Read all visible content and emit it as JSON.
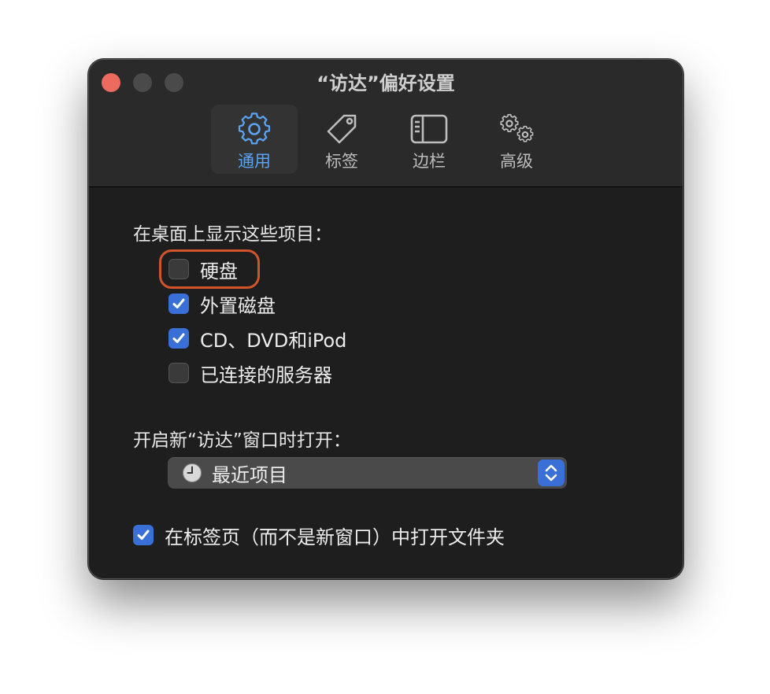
{
  "window": {
    "title": "“访达”偏好设置"
  },
  "toolbar": {
    "tabs": [
      {
        "label": "通用",
        "icon": "gear-icon",
        "active": true
      },
      {
        "label": "标签",
        "icon": "tag-icon",
        "active": false
      },
      {
        "label": "边栏",
        "icon": "sidebar-icon",
        "active": false
      },
      {
        "label": "高级",
        "icon": "gears-icon",
        "active": false
      }
    ]
  },
  "desktop": {
    "heading": "在桌面上显示这些项目：",
    "items": [
      {
        "label": "硬盘",
        "checked": false
      },
      {
        "label": "外置磁盘",
        "checked": true
      },
      {
        "label": "CD、DVD和iPod",
        "checked": true
      },
      {
        "label": "已连接的服务器",
        "checked": false
      }
    ]
  },
  "new_window": {
    "heading": "开启新“访达”窗口时打开：",
    "selected": "最近项目",
    "icon": "clock-icon"
  },
  "tabs_option": {
    "label": "在标签页（而不是新窗口）中打开文件夹",
    "checked": true
  },
  "colors": {
    "accent": "#3b6fd8",
    "active_tab": "#5ba4f5",
    "highlight": "#d2542a",
    "close_button": "#ec6a5e"
  }
}
